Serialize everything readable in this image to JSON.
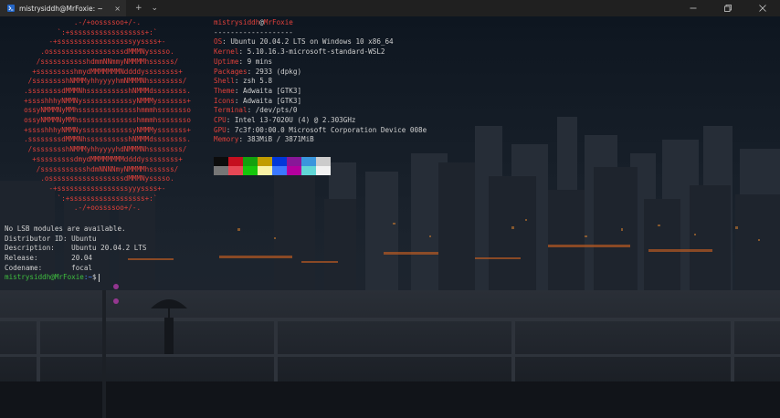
{
  "window": {
    "tab_title": "mistrysiddh@MrFoxie: ~",
    "tab_close": "×",
    "new_tab": "+",
    "dropdown": "⌄"
  },
  "logo_lines": [
    ".-/+oossssoo+/-.",
    "`:+ssssssssssssssssss+:`",
    "-+ssssssssssssssssssyyssss+-",
    ".ossssssssssssssssssdMMMNysssso.",
    "/ssssssssssshdmmNNmmyNMMMMhssssss/",
    "+ssssssssshmydMMMMMMMNddddyssssssss+",
    "/sssssssshNMMMyhhyyyyhmNMMMNhssssssss/",
    ".ssssssssdMMMNhsssssssssshNMMMdssssssss.",
    "+sssshhhyNMMNyssssssssssssyNMMMysssssss+",
    "ossyNMMMNyMMhsssssssssssssshmmmhssssssso",
    "ossyNMMMNyMMhsssssssssssssshmmmhssssssso",
    "+sssshhhyNMMNyssssssssssssyNMMMysssssss+",
    ".ssssssssdMMMNhsssssssssshNMMMdssssssss.",
    "/sssssssshNMMMyhhyyyyhdNMMMNhssssssss/",
    "+sssssssssdmydMMMMMMMMddddyssssssss+",
    "/ssssssssssshdmNNNNmyNMMMMhssssss/",
    ".ossssssssssssssssssdMMMNysssso.",
    "-+sssssssssssssssssyyyssss+-",
    "`:+ssssssssssssssssss+:`",
    ".-/+oossssoo+/-."
  ],
  "fetch": {
    "user": "mistrysiddh",
    "at": "@",
    "host": "MrFoxie",
    "separator": "-------------------",
    "rows": [
      {
        "key": "OS",
        "value": "Ubuntu 20.04.2 LTS on Windows 10 x86_64"
      },
      {
        "key": "Kernel",
        "value": "5.10.16.3-microsoft-standard-WSL2"
      },
      {
        "key": "Uptime",
        "value": "9 mins"
      },
      {
        "key": "Packages",
        "value": "2933 (dpkg)"
      },
      {
        "key": "Shell",
        "value": "zsh 5.8"
      },
      {
        "key": "Theme",
        "value": "Adwaita [GTK3]"
      },
      {
        "key": "Icons",
        "value": "Adwaita [GTK3]"
      },
      {
        "key": "Terminal",
        "value": "/dev/pts/0"
      },
      {
        "key": "CPU",
        "value": "Intel i3-7020U (4) @ 2.303GHz"
      },
      {
        "key": "GPU",
        "value": "7c3f:00:00.0 Microsoft Corporation Device 008e"
      },
      {
        "key": "Memory",
        "value": "383MiB / 3871MiB"
      }
    ],
    "colors_row1": [
      "#0c0c0c",
      "#c50f1f",
      "#13a10e",
      "#c19c00",
      "#0037da",
      "#881798",
      "#3a96dd",
      "#cccccc"
    ],
    "colors_row2": [
      "#767676",
      "#e74856",
      "#16c60c",
      "#f9f1a5",
      "#3b78ff",
      "#b4009e",
      "#61d6d6",
      "#f2f2f2"
    ]
  },
  "lsb": {
    "line1": "No LSB modules are available.",
    "id": "Distributor ID: Ubuntu",
    "desc": "Description:    Ubuntu 20.04.2 LTS",
    "release": "Release:        20.04",
    "codename": "Codename:       focal"
  },
  "prompt": {
    "user_host": "mistrysiddh@MrFoxie",
    "path": ":~",
    "symbol": "$"
  }
}
